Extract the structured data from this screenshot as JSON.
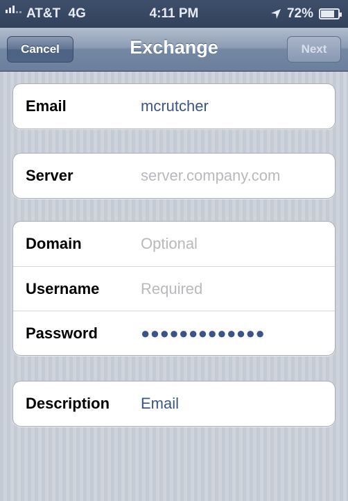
{
  "status_bar": {
    "carrier": "AT&T",
    "network": "4G",
    "time": "4:11 PM",
    "battery_percent": "72%",
    "battery_level": 0.72,
    "icons": [
      "signal-bars-icon",
      "location-arrow-icon",
      "battery-charging-icon"
    ]
  },
  "nav": {
    "title": "Exchange",
    "cancel_label": "Cancel",
    "next_label": "Next"
  },
  "fields": {
    "email": {
      "label": "Email",
      "value": "mcrutcher"
    },
    "server": {
      "label": "Server",
      "placeholder": "server.company.com"
    },
    "domain": {
      "label": "Domain",
      "placeholder": "Optional"
    },
    "username": {
      "label": "Username",
      "placeholder": "Required"
    },
    "password": {
      "label": "Password",
      "value": "●●●●●●●●●●●●●"
    },
    "description": {
      "label": "Description",
      "value": "Email"
    }
  }
}
